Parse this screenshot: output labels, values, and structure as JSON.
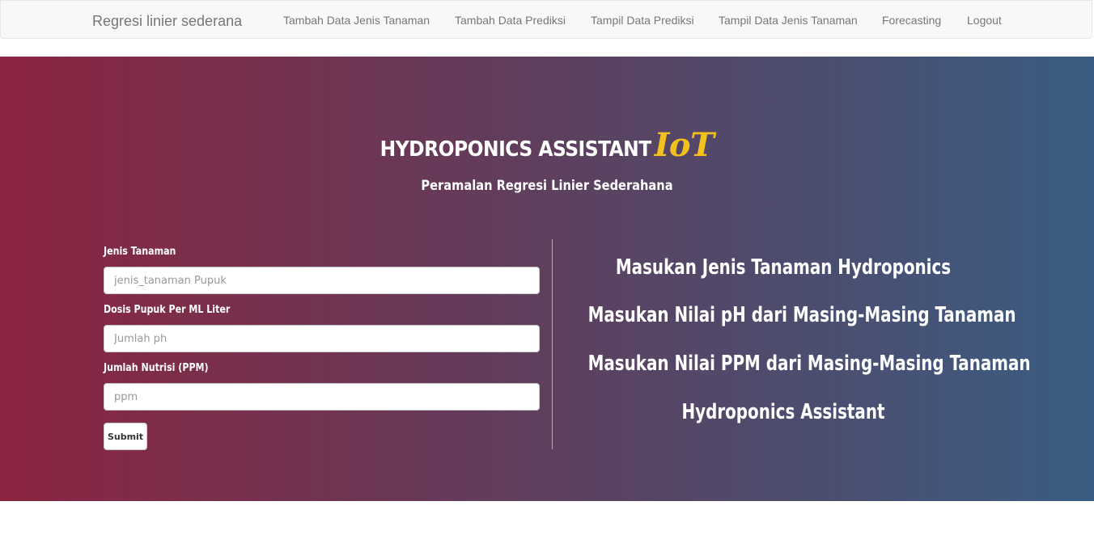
{
  "navbar": {
    "brand": "Regresi linier sederana",
    "links": [
      "Tambah Data Jenis Tanaman",
      "Tambah Data Prediksi",
      "Tampil Data Prediksi",
      "Tampil Data Jenis Tanaman",
      "Forecasting",
      "Logout"
    ]
  },
  "hero": {
    "title": "HYDROPONICS ASSISTANT",
    "title_accent": "IoT",
    "subtitle": "Peramalan Regresi Linier Sederahana",
    "accent_color": "#f3c11d"
  },
  "form": {
    "fields": [
      {
        "label": "Jenis Tanaman",
        "placeholder": "jenis_tanaman Pupuk",
        "value": ""
      },
      {
        "label": "Dosis Pupuk Per ML Liter",
        "placeholder": "Jumlah ph",
        "value": ""
      },
      {
        "label": "Jumlah Nutrisi (PPM)",
        "placeholder": "ppm",
        "value": ""
      }
    ],
    "submit_label": "Submit"
  },
  "info": {
    "lines": [
      "Masukan Jenis Tanaman Hydroponics",
      "Masukan Nilai pH dari Masing-Masing Tanaman",
      "Masukan Nilai PPM dari Masing-Masing Tanaman",
      "Hydroponics Assistant"
    ]
  }
}
